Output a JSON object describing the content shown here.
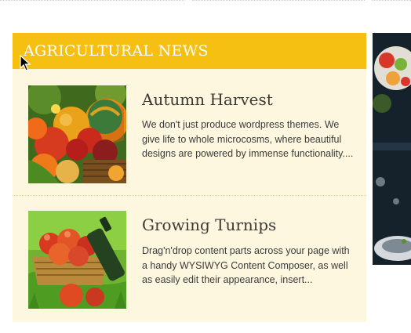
{
  "widget": {
    "title": "AGRICULTURAL NEWS"
  },
  "news": [
    {
      "title": "Autumn Harvest",
      "excerpt": "We don't just produce wordpress themes. We give life to whole microcosms, where beautiful designs are powered by immense functionality....",
      "image": "autumn-harvest-thumbnail"
    },
    {
      "title": "Growing Turnips",
      "excerpt": "Drag'n'drop content parts across your page with a handy WYSIWYG Content Composer, as well as easily edit their appearance, insert...",
      "image": "growing-turnips-thumbnail"
    }
  ],
  "colors": {
    "header": "#f6c013",
    "widget_bg": "#fdf7df",
    "title_text": "#3d3a35"
  }
}
